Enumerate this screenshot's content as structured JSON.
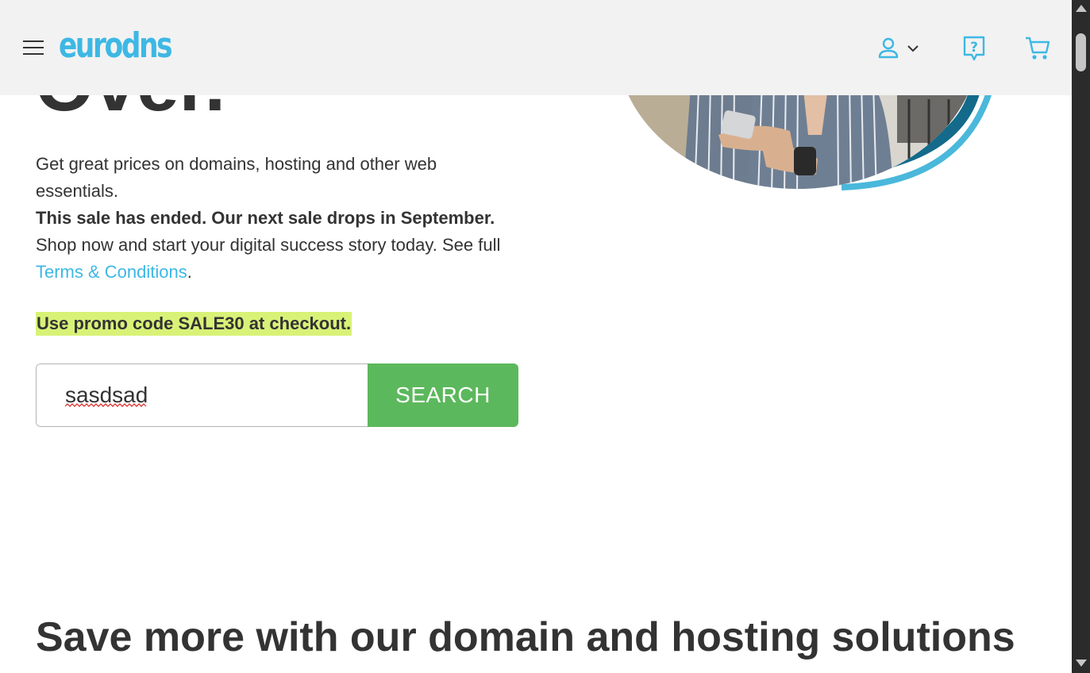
{
  "header": {
    "logo_text": "eurodns",
    "menu_icon": "hamburger-menu-icon",
    "account_icon": "user-icon",
    "account_dropdown_icon": "chevron-down-icon",
    "help_icon": "help-question-icon",
    "cart_icon": "shopping-cart-icon",
    "brand_color": "#3db8e4"
  },
  "hero": {
    "heading_fragment": "Over.",
    "description": "Get great prices on domains, hosting and other web essentials.",
    "sale_ended": "This sale has ended. Our next sale drops in September.",
    "shop_now": "Shop now and start your digital success story today. See full ",
    "terms_link": "Terms & Conditions",
    "terms_suffix": ".",
    "promo": "Use promo code SALE30 at checkout.",
    "promo_highlight_color": "#d8f277"
  },
  "search": {
    "value": "sasdsad",
    "button_label": "SEARCH",
    "button_color": "#5cb85c"
  },
  "section": {
    "title": "Save more with our domain and hosting solutions"
  }
}
